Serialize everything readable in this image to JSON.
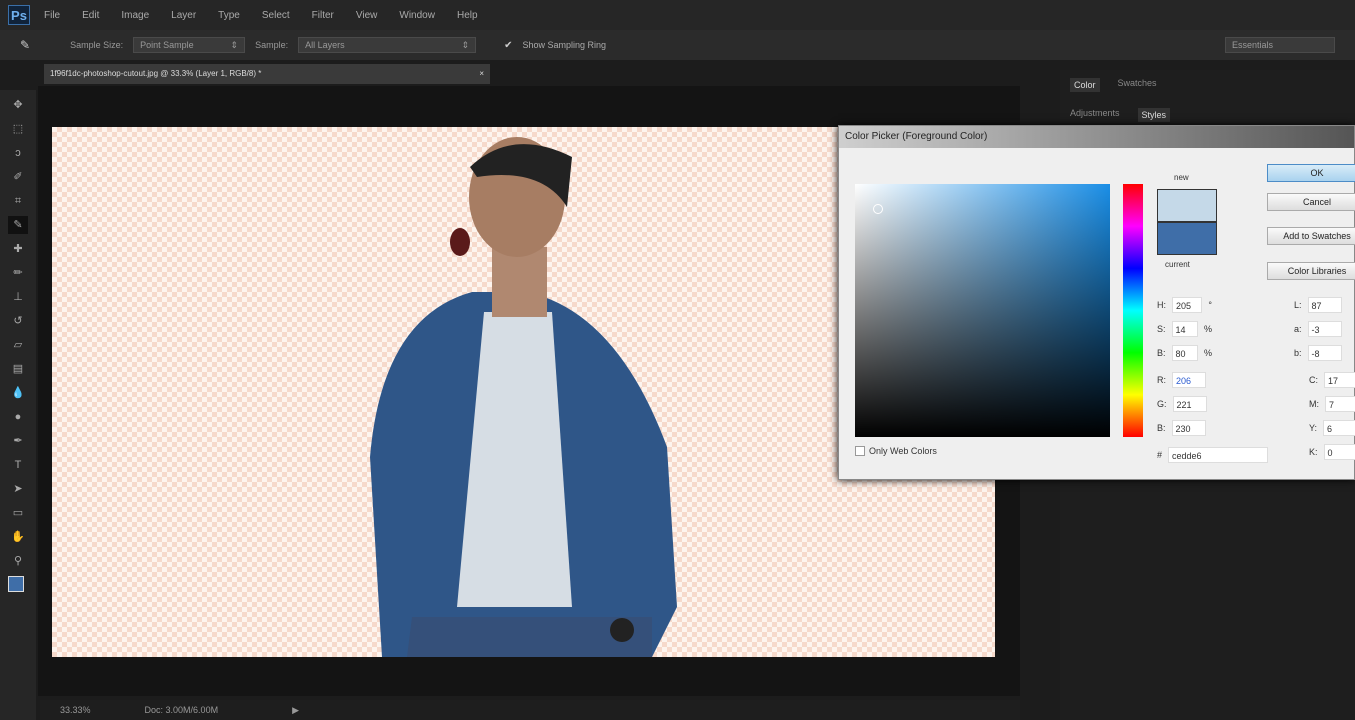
{
  "app": {
    "logo": "Ps",
    "menu": [
      "File",
      "Edit",
      "Image",
      "Layer",
      "Type",
      "Select",
      "Filter",
      "View",
      "Window",
      "Help"
    ]
  },
  "options": {
    "sample_size_label": "Sample Size:",
    "sample_size": "Point Sample",
    "sample_label": "Sample:",
    "sample": "All Layers",
    "show_ring": "Show Sampling Ring",
    "workspace": "Essentials"
  },
  "document": {
    "tab": "1f96f1dc-photoshop-cutout.jpg @ 33.3% (Layer 1, RGB/8) *"
  },
  "status": {
    "zoom": "33.33%",
    "doc": "Doc: 3.00M/6.00M"
  },
  "panels": {
    "tabs1": [
      "Color",
      "Swatches"
    ],
    "tabs2": [
      "Adjustments",
      "Styles"
    ]
  },
  "color_picker": {
    "title": "Color Picker (Foreground Color)",
    "new_label": "new",
    "current_label": "current",
    "new_color": "#c5d9e8",
    "current_color": "#3f6ea8",
    "buttons": {
      "ok": "OK",
      "cancel": "Cancel",
      "add_swatches": "Add to Swatches",
      "libraries": "Color Libraries"
    },
    "hsb": [
      {
        "label": "H:",
        "value": "205",
        "unit": "°"
      },
      {
        "label": "S:",
        "value": "14",
        "unit": "%"
      },
      {
        "label": "B:",
        "value": "80",
        "unit": "%"
      }
    ],
    "rgb": [
      {
        "label": "R:",
        "value": "206"
      },
      {
        "label": "G:",
        "value": "221"
      },
      {
        "label": "B:",
        "value": "230"
      }
    ],
    "lab": [
      {
        "label": "L:",
        "value": "87"
      },
      {
        "label": "a:",
        "value": "-3"
      },
      {
        "label": "b:",
        "value": "-8"
      }
    ],
    "cmyk": [
      {
        "label": "C:",
        "value": "17"
      },
      {
        "label": "M:",
        "value": "7"
      },
      {
        "label": "Y:",
        "value": "6"
      },
      {
        "label": "K:",
        "value": "0"
      }
    ],
    "only_web": "Only Web Colors",
    "hex_label": "#",
    "hex": "cedde6"
  }
}
